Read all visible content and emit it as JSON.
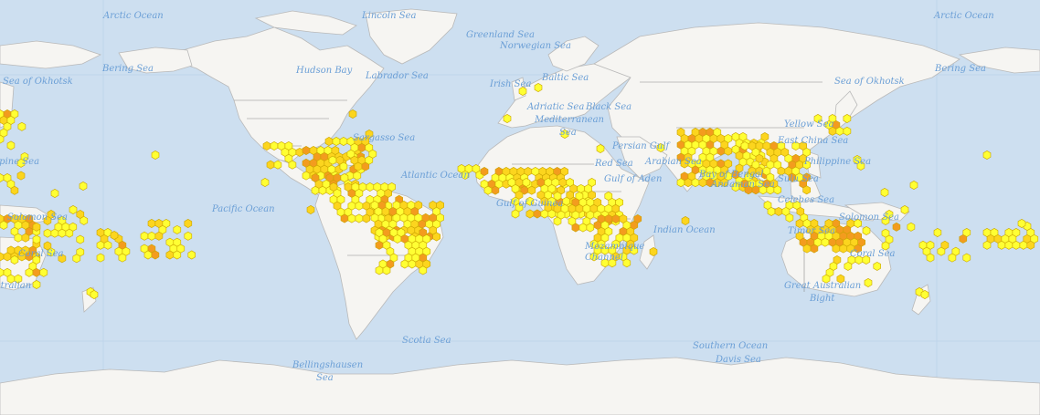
{
  "map": {
    "colors": {
      "ocean": "#cddff0",
      "land": "#f6f5f2",
      "border": "#8a8a8a",
      "label": "#6b9fd6",
      "hex_low": "#ffff33",
      "hex_mid": "#fcd51e",
      "hex_high": "#f39c1e"
    },
    "labels": {
      "arctic_w": "Arctic Ocean",
      "arctic_e": "Arctic Ocean",
      "lincoln": "Lincoln Sea",
      "greenland": "Greenland Sea",
      "norwegian": "Norwegian Sea",
      "bering_w": "Bering Sea",
      "bering_e": "Bering Sea",
      "okhotsk_w": "Sea of Okhotsk",
      "okhotsk_e": "Sea of Okhotsk",
      "hudson": "Hudson Bay",
      "labrador": "Labrador Sea",
      "irish": "Irish Sea",
      "baltic": "Baltic Sea",
      "adriatic": "Adriatic Sea",
      "black": "Black Sea",
      "mediterranean": "Mediterranean",
      "mediterranean2": "Sea",
      "sargasso": "Sargasso Sea",
      "atlantic": "Atlantic Ocean",
      "pacific": "Pacific Ocean",
      "gulf_guinea": "Gulf of Guinea",
      "red_sea": "Red Sea",
      "persian": "Persian Gulf",
      "arabian": "Arabian Sea",
      "gulf_aden": "Gulf of Aden",
      "bay_bengal": "Bay of Bengal",
      "andaman": "Andaman Sea",
      "indian": "Indian Ocean",
      "mozambique": "Mozambique Channel",
      "yellow": "Yellow Sea",
      "east_china": "East China Sea",
      "philippine_e": "Philippine Sea",
      "philippine_w": "Philippine Sea",
      "sulu": "Sulu Sea",
      "celebes": "Celebes Sea",
      "coral_e": "Coral Sea",
      "coral_w": "Coral Sea",
      "solomon_w": "Solomon Sea",
      "solomon_e": "Solomon Sea",
      "timor": "Timor Sea",
      "great_aus1": "Great Australian",
      "great_aus2": "Bight",
      "great_aus_w": "Great Australian",
      "scotia": "Scotia Sea",
      "southern": "Southern Ocean",
      "davis": "Davis Sea",
      "bellings1": "Bellingshausen",
      "bellings2": "Sea"
    }
  }
}
